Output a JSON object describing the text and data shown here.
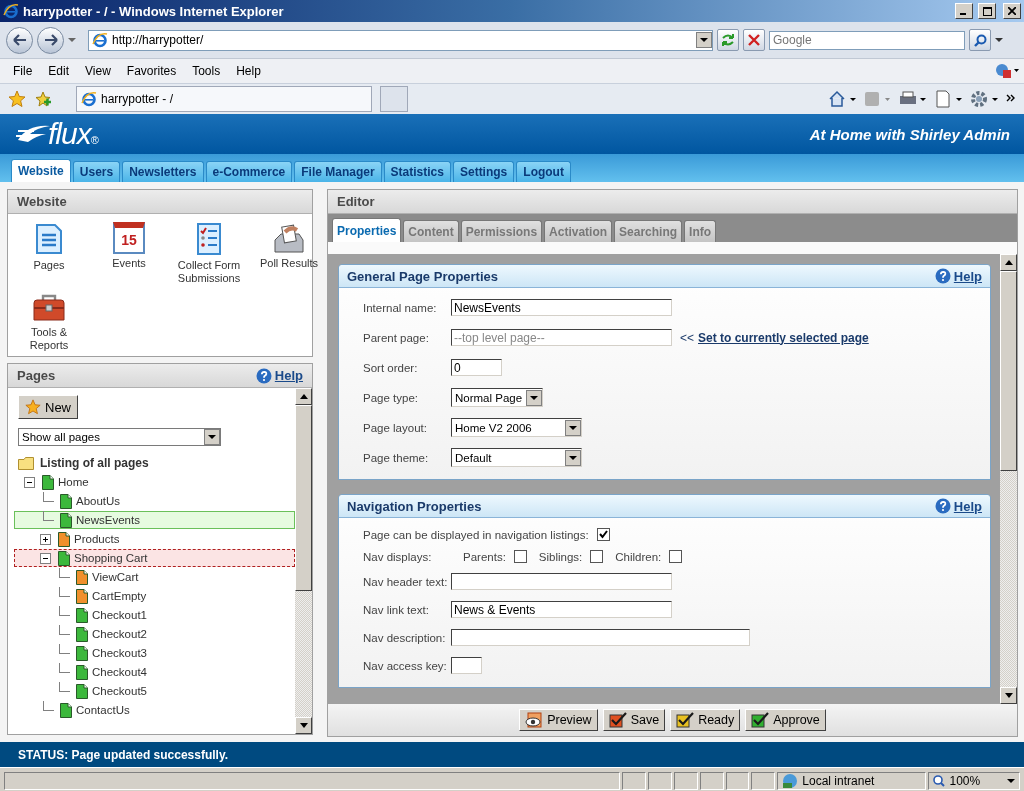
{
  "window": {
    "title": "harrypotter - / - Windows Internet Explorer"
  },
  "address_bar": {
    "url": "http://harrypotter/"
  },
  "search": {
    "placeholder": "Google"
  },
  "menu": [
    "File",
    "Edit",
    "View",
    "Favorites",
    "Tools",
    "Help"
  ],
  "browser_tab": {
    "title": "harrypotter - /"
  },
  "app_header": {
    "logo": "flux",
    "logo_mark": "®",
    "greeting": "At Home with Shirley Admin"
  },
  "nav_tabs": [
    {
      "label": "Website",
      "selected": true
    },
    {
      "label": "Users",
      "selected": false
    },
    {
      "label": "Newsletters",
      "selected": false
    },
    {
      "label": "e-Commerce",
      "selected": false
    },
    {
      "label": "File Manager",
      "selected": false
    },
    {
      "label": "Statistics",
      "selected": false
    },
    {
      "label": "Settings",
      "selected": false
    },
    {
      "label": "Logout",
      "selected": false
    }
  ],
  "website_panel": {
    "title": "Website",
    "tools": [
      {
        "kind": "pages",
        "label": "Pages"
      },
      {
        "kind": "events",
        "label": "Events",
        "icon_text": "15"
      },
      {
        "kind": "forms",
        "label": "Collect Form Submissions"
      },
      {
        "kind": "poll",
        "label": "Poll Results"
      },
      {
        "kind": "toolbox",
        "label": "Tools & Reports"
      }
    ]
  },
  "pages_panel": {
    "title": "Pages",
    "help": "Help",
    "new_button": "New",
    "filter": "Show all pages",
    "root": {
      "label": "Listing of all pages",
      "children": [
        {
          "label": "Home",
          "color": "#3cb83c",
          "selected": false,
          "marked": false,
          "expanded": true,
          "children": [
            {
              "label": "AboutUs",
              "color": "#3cb83c",
              "selected": false,
              "marked": false
            },
            {
              "label": "NewsEvents",
              "color": "#3cb83c",
              "selected": true,
              "marked": false
            },
            {
              "label": "Products",
              "color": "#f0902c",
              "selected": false,
              "marked": false,
              "expanded": false
            },
            {
              "label": "Shopping Cart",
              "color": "#3cb83c",
              "selected": false,
              "marked": true,
              "expanded": true,
              "children": [
                {
                  "label": "ViewCart",
                  "color": "#f0902c",
                  "selected": false,
                  "marked": false
                },
                {
                  "label": "CartEmpty",
                  "color": "#f0902c",
                  "selected": false,
                  "marked": false
                },
                {
                  "label": "Checkout1",
                  "color": "#3cb83c",
                  "selected": false,
                  "marked": false
                },
                {
                  "label": "Checkout2",
                  "color": "#3cb83c",
                  "selected": false,
                  "marked": false
                },
                {
                  "label": "Checkout3",
                  "color": "#3cb83c",
                  "selected": false,
                  "marked": false
                },
                {
                  "label": "Checkout4",
                  "color": "#3cb83c",
                  "selected": false,
                  "marked": false
                },
                {
                  "label": "Checkout5",
                  "color": "#3cb83c",
                  "selected": false,
                  "marked": false
                }
              ]
            },
            {
              "label": "ContactUs",
              "color": "#3cb83c",
              "selected": false,
              "marked": false
            }
          ]
        }
      ]
    }
  },
  "editor": {
    "title": "Editor",
    "tabs": [
      {
        "label": "Properties",
        "selected": true
      },
      {
        "label": "Content",
        "selected": false
      },
      {
        "label": "Permissions",
        "selected": false
      },
      {
        "label": "Activation",
        "selected": false
      },
      {
        "label": "Searching",
        "selected": false
      },
      {
        "label": "Info",
        "selected": false
      }
    ],
    "sections": [
      {
        "title": "General Page Properties",
        "help": "Help",
        "fields": [
          {
            "kind": "text",
            "label": "Internal name:",
            "value": "NewsEvents"
          },
          {
            "kind": "picker",
            "label": "Parent page:",
            "placeholder": "--top level page--",
            "prefix": "<<",
            "link": "Set to currently selected page"
          },
          {
            "kind": "short-text",
            "label": "Sort order:",
            "value": "0"
          },
          {
            "kind": "short-select",
            "label": "Page type:",
            "value": "Normal Page"
          },
          {
            "kind": "select",
            "label": "Page layout:",
            "value": "Home V2 2006"
          },
          {
            "kind": "select",
            "label": "Page theme:",
            "value": "Default"
          }
        ]
      },
      {
        "title": "Navigation Properties",
        "help": "Help",
        "fields": [
          {
            "kind": "checkbox",
            "label": "Page can be displayed in navigation listings:",
            "checked": true
          },
          {
            "kind": "checkgroup",
            "label": "Nav displays:",
            "options": [
              {
                "label": "Parents:",
                "checked": false
              },
              {
                "label": "Siblings:",
                "checked": false
              },
              {
                "label": "Children:",
                "checked": false
              }
            ]
          },
          {
            "kind": "text",
            "label": "Nav header text:"
          },
          {
            "kind": "text",
            "label": "Nav link text:",
            "value": "News & Events"
          },
          {
            "kind": "long-text",
            "label": "Nav description:"
          },
          {
            "kind": "tiny-text",
            "label": "Nav access key:"
          }
        ]
      }
    ],
    "buttons": [
      {
        "kind": "preview",
        "label": "Preview"
      },
      {
        "kind": "save",
        "label": "Save"
      },
      {
        "kind": "ready",
        "label": "Ready"
      },
      {
        "kind": "approve",
        "label": "Approve"
      }
    ]
  },
  "status": {
    "text": "STATUS: Page updated successfully."
  },
  "ie_status": {
    "zone": "Local intranet",
    "zoom": "100%"
  }
}
